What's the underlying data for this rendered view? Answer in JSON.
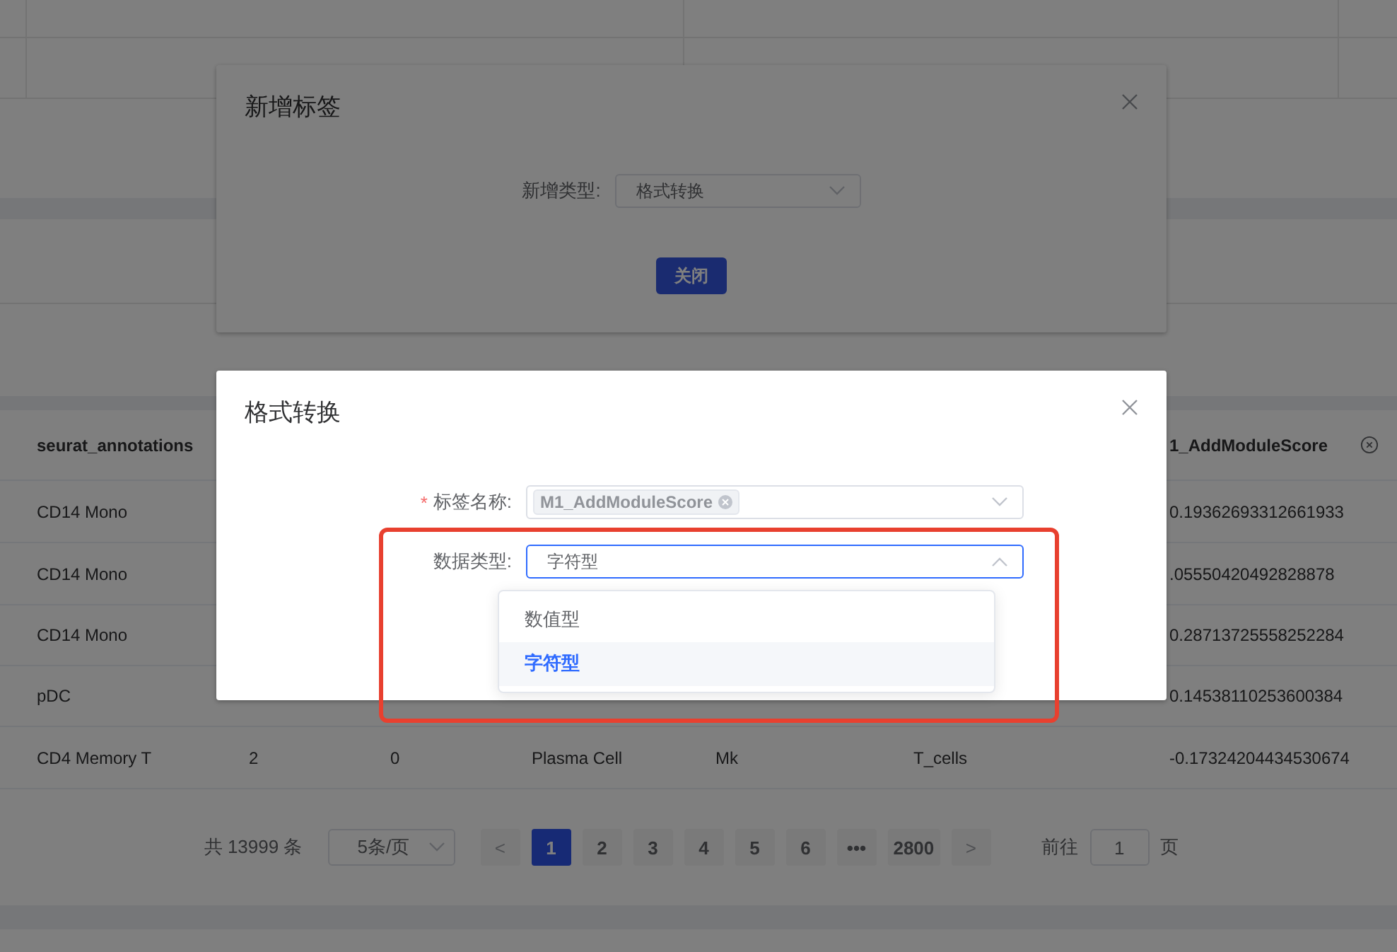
{
  "table": {
    "columns": [
      "seurat_annotations",
      null,
      null,
      null,
      null,
      null,
      "1_AddModuleScore"
    ],
    "rows": [
      {
        "cells": [
          "CD14 Mono",
          null,
          null,
          null,
          null,
          null,
          "0.19362693312661933"
        ]
      },
      {
        "cells": [
          "CD14 Mono",
          null,
          null,
          null,
          null,
          null,
          ".05550420492828878"
        ]
      },
      {
        "cells": [
          "CD14 Mono",
          null,
          null,
          null,
          null,
          null,
          "0.28713725558252284"
        ]
      },
      {
        "cells": [
          "pDC",
          null,
          null,
          null,
          null,
          null,
          "0.14538110253600384"
        ]
      },
      {
        "cells": [
          "CD4 Memory T",
          "2",
          "0",
          "Plasma Cell",
          "Mk",
          "T_cells",
          "-0.17324204434530674"
        ]
      }
    ]
  },
  "pagination": {
    "total": "共 13999 条",
    "page_size": "5条/页",
    "prev": "<",
    "next": ">",
    "pages": [
      {
        "label": "1",
        "selected": true
      },
      {
        "label": "2",
        "selected": false
      },
      {
        "label": "3",
        "selected": false
      },
      {
        "label": "4",
        "selected": false
      },
      {
        "label": "5",
        "selected": false
      },
      {
        "label": "6",
        "selected": false
      },
      {
        "label": "•••",
        "selected": false
      },
      {
        "label": "2800",
        "selected": false
      }
    ],
    "goto_label": "前往",
    "goto_value": "1",
    "goto_suffix": "页"
  },
  "add_tag_dialog": {
    "title": "新增标签",
    "type_label": "新增类型:",
    "type_value": "格式转换",
    "close_button": "关闭"
  },
  "convert_dialog": {
    "title": "格式转换",
    "name_label": "标签名称:",
    "required_mark": "*",
    "name_tag": "M1_AddModuleScore",
    "data_type_label": "数据类型:",
    "data_type_value": "字符型",
    "dropdown_open": true,
    "options": [
      {
        "label": "数值型",
        "selected": false
      },
      {
        "label": "字符型",
        "selected": true
      }
    ]
  }
}
